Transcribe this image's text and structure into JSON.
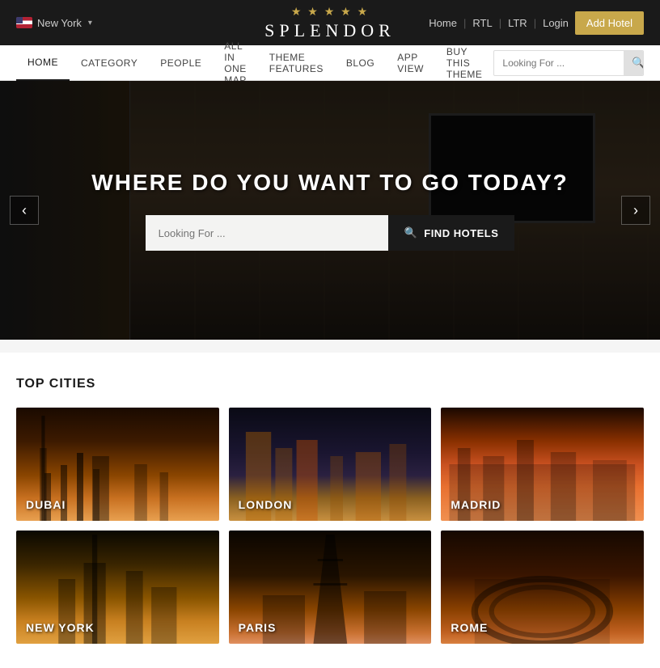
{
  "header": {
    "location": "New York",
    "logo_stars": "★ ★ ★ ★ ★",
    "logo_text": "SPLENDOR",
    "nav_home": "Home",
    "nav_rtl": "RTL",
    "nav_ltr": "LTR",
    "nav_login": "Login",
    "add_hotel_label": "Add Hotel"
  },
  "nav": {
    "items": [
      {
        "label": "HOME",
        "active": true
      },
      {
        "label": "CATEGORY"
      },
      {
        "label": "PEOPLE"
      },
      {
        "label": "ALL IN ONE MAP"
      },
      {
        "label": "THEME FEATURES"
      },
      {
        "label": "BLOG"
      },
      {
        "label": "APP VIEW"
      },
      {
        "label": "BUY THIS THEME"
      }
    ],
    "search_placeholder": "Looking For ..."
  },
  "hero": {
    "title": "WHERE DO YOU WANT TO GO TODAY?",
    "search_placeholder": "Looking For ...",
    "find_btn": "FIND HOTELS"
  },
  "top_cities": {
    "section_title": "TOP CITIES",
    "cities": [
      {
        "name": "DUBAI"
      },
      {
        "name": "LONDON"
      },
      {
        "name": "MADRID"
      },
      {
        "name": "NEW YORK"
      },
      {
        "name": "PARIS"
      },
      {
        "name": "ROME"
      }
    ]
  }
}
